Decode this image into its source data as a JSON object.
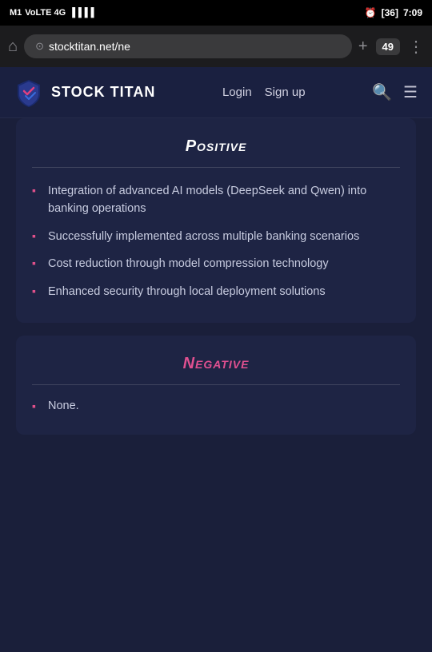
{
  "statusBar": {
    "carrier": "M1",
    "network": "VoLTE 4G",
    "time": "7:09",
    "battery": "36"
  },
  "browser": {
    "url": "stocktitan.net/ne",
    "tabCount": "49",
    "homeIcon": "⌂",
    "addIcon": "+",
    "moreIcon": "⋮"
  },
  "nav": {
    "logoText": "STOCK TITAN",
    "loginLabel": "Login",
    "signupLabel": "Sign up",
    "searchIcon": "🔍",
    "menuIcon": "☰"
  },
  "positive": {
    "title": "Positive",
    "divider": true,
    "bullets": [
      "Integration of advanced AI models (DeepSeek and Qwen) into banking operations",
      "Successfully implemented across multiple banking scenarios",
      "Cost reduction through model compression technology",
      "Enhanced security through local deployment solutions"
    ]
  },
  "negative": {
    "title": "Negative",
    "divider": true,
    "bullets": [
      "None."
    ]
  }
}
